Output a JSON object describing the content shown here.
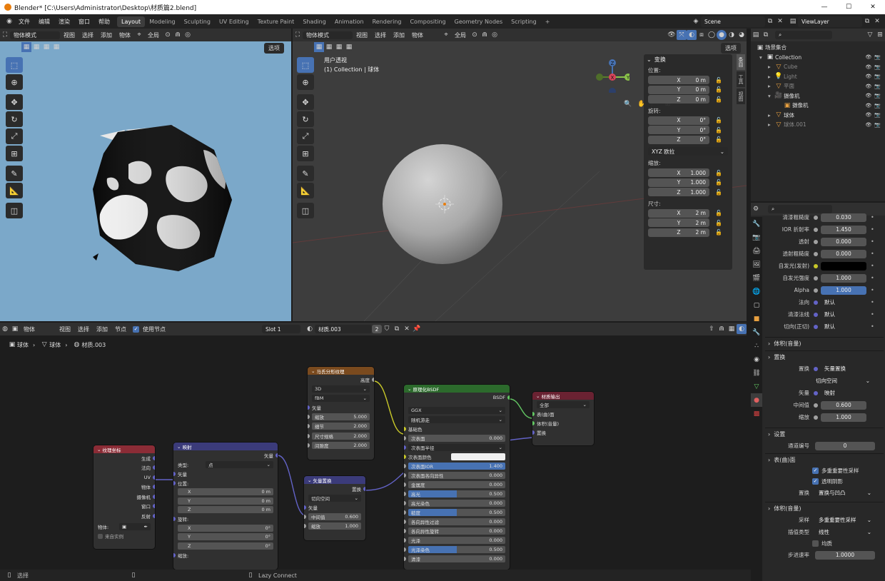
{
  "title": {
    "text": "Blender* [C:\\Users\\Administrator\\Desktop\\材质篇2.blend]",
    "minimize": "—",
    "maximize": "☐",
    "close": "✕"
  },
  "topbar": {
    "menus": [
      "文件",
      "编辑",
      "渲染",
      "窗口",
      "帮助"
    ],
    "tabs": [
      "Layout",
      "Modeling",
      "Sculpting",
      "UV Editing",
      "Texture Paint",
      "Shading",
      "Animation",
      "Rendering",
      "Compositing",
      "Geometry Nodes",
      "Scripting"
    ],
    "active_tab": "Layout",
    "add_tab": "+",
    "scene": "Scene",
    "viewlayer": "ViewLayer"
  },
  "left_vp": {
    "mode": "物体模式",
    "menus": [
      "视图",
      "选择",
      "添加",
      "物体"
    ],
    "transform": "全局",
    "options": "选项"
  },
  "mid_vp": {
    "mode": "物体模式",
    "menus": [
      "视图",
      "选择",
      "添加",
      "物体"
    ],
    "transform": "全局",
    "options": "选项",
    "view_name": "用户透视",
    "view_sub": "(1) Collection | 球体"
  },
  "npanel": {
    "header": "变换",
    "location": "位置:",
    "rotation": "旋转:",
    "scale": "缩放:",
    "dimensions": "尺寸:",
    "mode": "XYZ 欧拉",
    "loc": [
      [
        "X",
        "0 m"
      ],
      [
        "Y",
        "0 m"
      ],
      [
        "Z",
        "0 m"
      ]
    ],
    "rot": [
      [
        "X",
        "0°"
      ],
      [
        "Y",
        "0°"
      ],
      [
        "Z",
        "0°"
      ]
    ],
    "scl": [
      [
        "X",
        "1.000"
      ],
      [
        "Y",
        "1.000"
      ],
      [
        "Z",
        "1.000"
      ]
    ],
    "dim": [
      [
        "X",
        "2 m"
      ],
      [
        "Y",
        "2 m"
      ],
      [
        "Z",
        "2 m"
      ]
    ],
    "tabs": [
      "条目",
      "工具",
      "视图"
    ]
  },
  "gizmo": {
    "x": "X",
    "y": "Y",
    "z": "Z"
  },
  "outliner": {
    "root": "场景集合",
    "items": [
      {
        "label": "Collection",
        "level": 0,
        "color": "#ddd"
      },
      {
        "label": "Cube",
        "level": 1,
        "color": "#888"
      },
      {
        "label": "Light",
        "level": 1,
        "color": "#888"
      },
      {
        "label": "平面",
        "level": 1,
        "color": "#888"
      },
      {
        "label": "摄像机",
        "level": 1,
        "color": "#ddd"
      },
      {
        "label": "摄像机",
        "level": 2,
        "color": "#ddd"
      },
      {
        "label": "球体",
        "level": 1,
        "color": "#ddd"
      },
      {
        "label": "球体.001",
        "level": 1,
        "color": "#888"
      }
    ]
  },
  "props": {
    "rows": [
      {
        "label": "清漆粗糙度",
        "value": "0.030",
        "type": "num"
      },
      {
        "label": "IOR 折射率",
        "value": "1.450",
        "type": "num"
      },
      {
        "label": "透射",
        "value": "0.000",
        "type": "num"
      },
      {
        "label": "透射粗糙度",
        "value": "0.000",
        "type": "num"
      },
      {
        "label": "自发光(发射)",
        "value": "",
        "type": "color"
      },
      {
        "label": "自发光强度",
        "value": "1.000",
        "type": "num"
      },
      {
        "label": "Alpha",
        "value": "1.000",
        "type": "blue"
      },
      {
        "label": "法向",
        "value": "默认",
        "type": "dark"
      },
      {
        "label": "清漆法线",
        "value": "默认",
        "type": "dark"
      },
      {
        "label": "切向(正切)",
        "value": "默认",
        "type": "dark"
      }
    ],
    "vol_section": "体积(音量)",
    "disp_section": "置换",
    "disp_label": "置换",
    "disp_value": "矢量置换",
    "tangent": "切向空间",
    "vec_label": "矢量",
    "vec_value": "映射",
    "mid_label": "中间值",
    "mid_value": "0.600",
    "scale_label": "缩放",
    "scale_value": "1.000",
    "settings_section": "设置",
    "pass_label": "通道编号",
    "pass_value": "0",
    "surface_section": "表(曲)面",
    "cb1": "多重重要性采样",
    "cb2": "透明阴影",
    "disp2_label": "置换",
    "disp2_value": "置换与凹凸",
    "vol2_section": "体积(音量)",
    "sample_label": "采样",
    "sample_value": "多重重要性采样",
    "interp_label": "插值类型",
    "interp_value": "线性",
    "homo": "均质",
    "step_label": "步进速率",
    "step_value": "1.0000"
  },
  "node_hdr": {
    "mode": "物体",
    "menus": [
      "视图",
      "选择",
      "添加",
      "节点"
    ],
    "use_nodes": "使用节点",
    "slot": "Slot 1",
    "material": "材质.003",
    "users": "2"
  },
  "breadcrumb": [
    "球体",
    "球体",
    "材质.003"
  ],
  "nodes": {
    "texcoord": {
      "title": "纹理坐标",
      "outs": [
        "生成",
        "法向",
        "UV",
        "物体",
        "摄像机",
        "窗口",
        "反射"
      ],
      "object_label": "物体:",
      "from_inst": "来自实例"
    },
    "mapping": {
      "title": "映射",
      "out": "矢量",
      "type_label": "类型:",
      "type_value": "点",
      "vector": "矢量",
      "loc": "位置:",
      "rot": "旋转:",
      "scl": "缩放:",
      "loc_vals": [
        [
          "X",
          "0 m"
        ],
        [
          "Y",
          "0 m"
        ],
        [
          "Z",
          "0 m"
        ]
      ],
      "rot_vals": [
        [
          "X",
          "0°"
        ],
        [
          "Y",
          "0°"
        ],
        [
          "Z",
          "0°"
        ]
      ]
    },
    "musgrave": {
      "title": "马氏分形纹理",
      "out": "高度",
      "dim": "3D",
      "type": "fBM",
      "vec": "矢量",
      "rows": [
        [
          "缩放",
          "5.000"
        ],
        [
          "细节",
          "2.000"
        ],
        [
          "尺寸规格",
          "2.000"
        ],
        [
          "间隙度",
          "2.000"
        ]
      ]
    },
    "vdisp": {
      "title": "矢量置换",
      "out": "置换",
      "space": "切向空间",
      "vec": "矢量",
      "rows": [
        [
          "中间值",
          "0.600"
        ],
        [
          "缩放",
          "1.000"
        ]
      ]
    },
    "bsdf": {
      "title": "原理化BSDF",
      "out": "BSDF",
      "dist": "GGX",
      "ss": "随机游走",
      "base": "基础色",
      "rows": [
        [
          "次表面",
          "0.000",
          "n"
        ],
        [
          "次表面半径",
          "",
          "d"
        ],
        [
          "次表面颜色",
          "",
          "w"
        ],
        [
          "次表面IOR",
          "1.400",
          "b"
        ],
        [
          "次表面各向异性",
          "0.000",
          "n"
        ],
        [
          "金属度",
          "0.000",
          "n"
        ],
        [
          "高光",
          "0.500",
          "b"
        ],
        [
          "高光染色",
          "0.000",
          "n"
        ],
        [
          "糙度",
          "0.500",
          "b"
        ],
        [
          "各向异性过滤",
          "0.000",
          "n"
        ],
        [
          "各向异性旋转",
          "0.000",
          "n"
        ],
        [
          "光泽",
          "0.000",
          "n"
        ],
        [
          "光泽染色",
          "0.500",
          "b"
        ],
        [
          "清漆",
          "0.000",
          "n"
        ]
      ]
    },
    "output": {
      "title": "材质输出",
      "target": "全部",
      "ins": [
        "表(曲)面",
        "体积(音量)",
        "置换"
      ]
    }
  },
  "status": {
    "select": "选择",
    "lazy": "Lazy Connect"
  }
}
